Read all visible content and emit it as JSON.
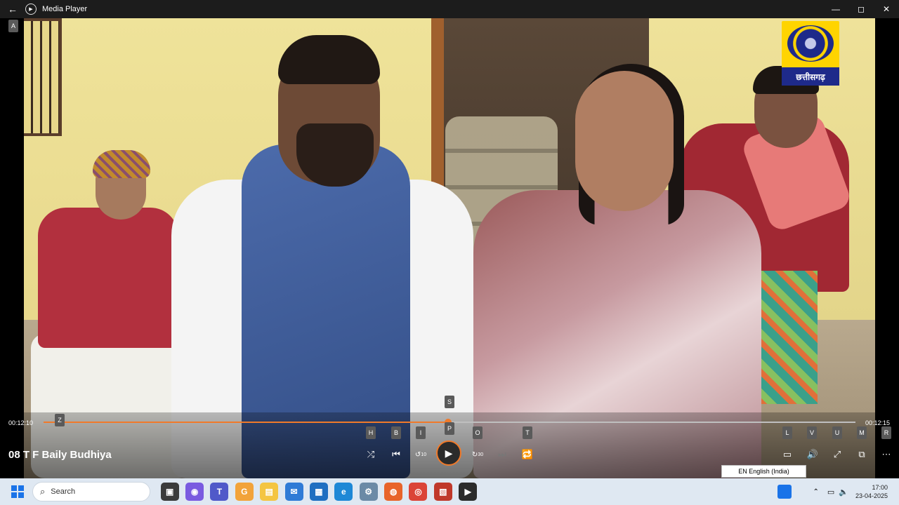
{
  "window": {
    "title": "Media Player",
    "back_icon": "back-arrow-icon",
    "minimize": "—",
    "maximize": "◻",
    "close": "✕"
  },
  "channel_logo": {
    "caption": "छत्तीसगढ़"
  },
  "keytips": [
    "A",
    "Z",
    "S",
    "P",
    "H",
    "B",
    "I",
    "O",
    "T",
    "L",
    "V",
    "U",
    "M",
    "R"
  ],
  "player": {
    "elapsed": "00:12:10",
    "remaining": "00:12:15",
    "progress_percent": 49.8,
    "media_title": "08 T F Baily Budhiya",
    "skip_back_label": "10",
    "skip_forward_label": "30",
    "accent_color": "#f07a2a"
  },
  "language_indicator": "EN English (India)",
  "taskbar": {
    "search_placeholder": "Search",
    "clock_time": "17:00",
    "clock_date": "23-04-2025"
  }
}
